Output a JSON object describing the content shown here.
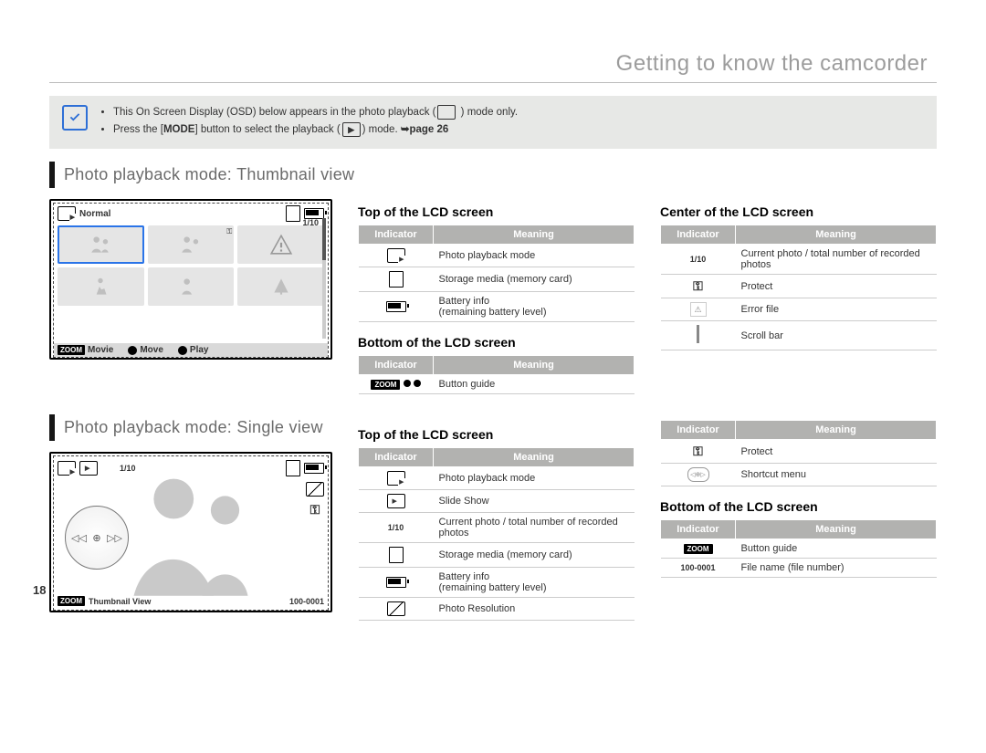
{
  "page_number": "18",
  "title": "Getting to know the camcorder",
  "note": {
    "line1_pre": "This On Screen Display (OSD) below appears in the photo playback (",
    "line1_post": " ) mode only.",
    "line2_pre": "Press the [",
    "line2_mode": "MODE",
    "line2_mid": "] button to select the playback (",
    "line2_post": ") mode. ",
    "line2_ref": "➥page 26"
  },
  "section1": {
    "heading": "Photo playback mode: Thumbnail view",
    "lcd_top_left": "Normal",
    "lcd_counter": "1/10",
    "bottom_items": {
      "movie": "Movie",
      "move": "Move",
      "play": "Play"
    }
  },
  "section2": {
    "heading": "Photo playback mode: Single view",
    "counter": "1/10",
    "bottom_left": "Thumbnail View",
    "bottom_right": "100-0001"
  },
  "tables": {
    "th_indicator": "Indicator",
    "th_meaning": "Meaning",
    "top1_hdr": "Top of the LCD screen",
    "bottom1_hdr": "Bottom of the LCD screen",
    "center1_hdr": "Center of the LCD screen",
    "top2_hdr": "Top of the LCD screen",
    "bottom2_hdr": "Bottom of the LCD screen",
    "top1": [
      {
        "meaning": "Photo playback mode"
      },
      {
        "meaning": "Storage media (memory card)"
      },
      {
        "meaning": "Battery info\n(remaining battery level)"
      }
    ],
    "bottom1": [
      {
        "meaning": "Button guide"
      }
    ],
    "center1": [
      {
        "label": "1/10",
        "meaning": "Current photo / total number of recorded photos"
      },
      {
        "meaning": "Protect"
      },
      {
        "meaning": "Error file"
      },
      {
        "meaning": "Scroll bar"
      }
    ],
    "top2_left": [
      {
        "meaning": "Photo playback mode"
      },
      {
        "meaning": "Slide Show"
      },
      {
        "label": "1/10",
        "meaning": "Current photo / total number of recorded photos"
      },
      {
        "meaning": "Storage media (memory card)"
      },
      {
        "meaning": "Battery info\n(remaining battery level)"
      },
      {
        "meaning": "Photo Resolution"
      }
    ],
    "top2_right": [
      {
        "meaning": "Protect"
      },
      {
        "meaning": "Shortcut menu"
      }
    ],
    "bottom2": [
      {
        "meaning": "Button guide"
      },
      {
        "label": "100-0001",
        "meaning": "File name (file number)"
      }
    ]
  }
}
